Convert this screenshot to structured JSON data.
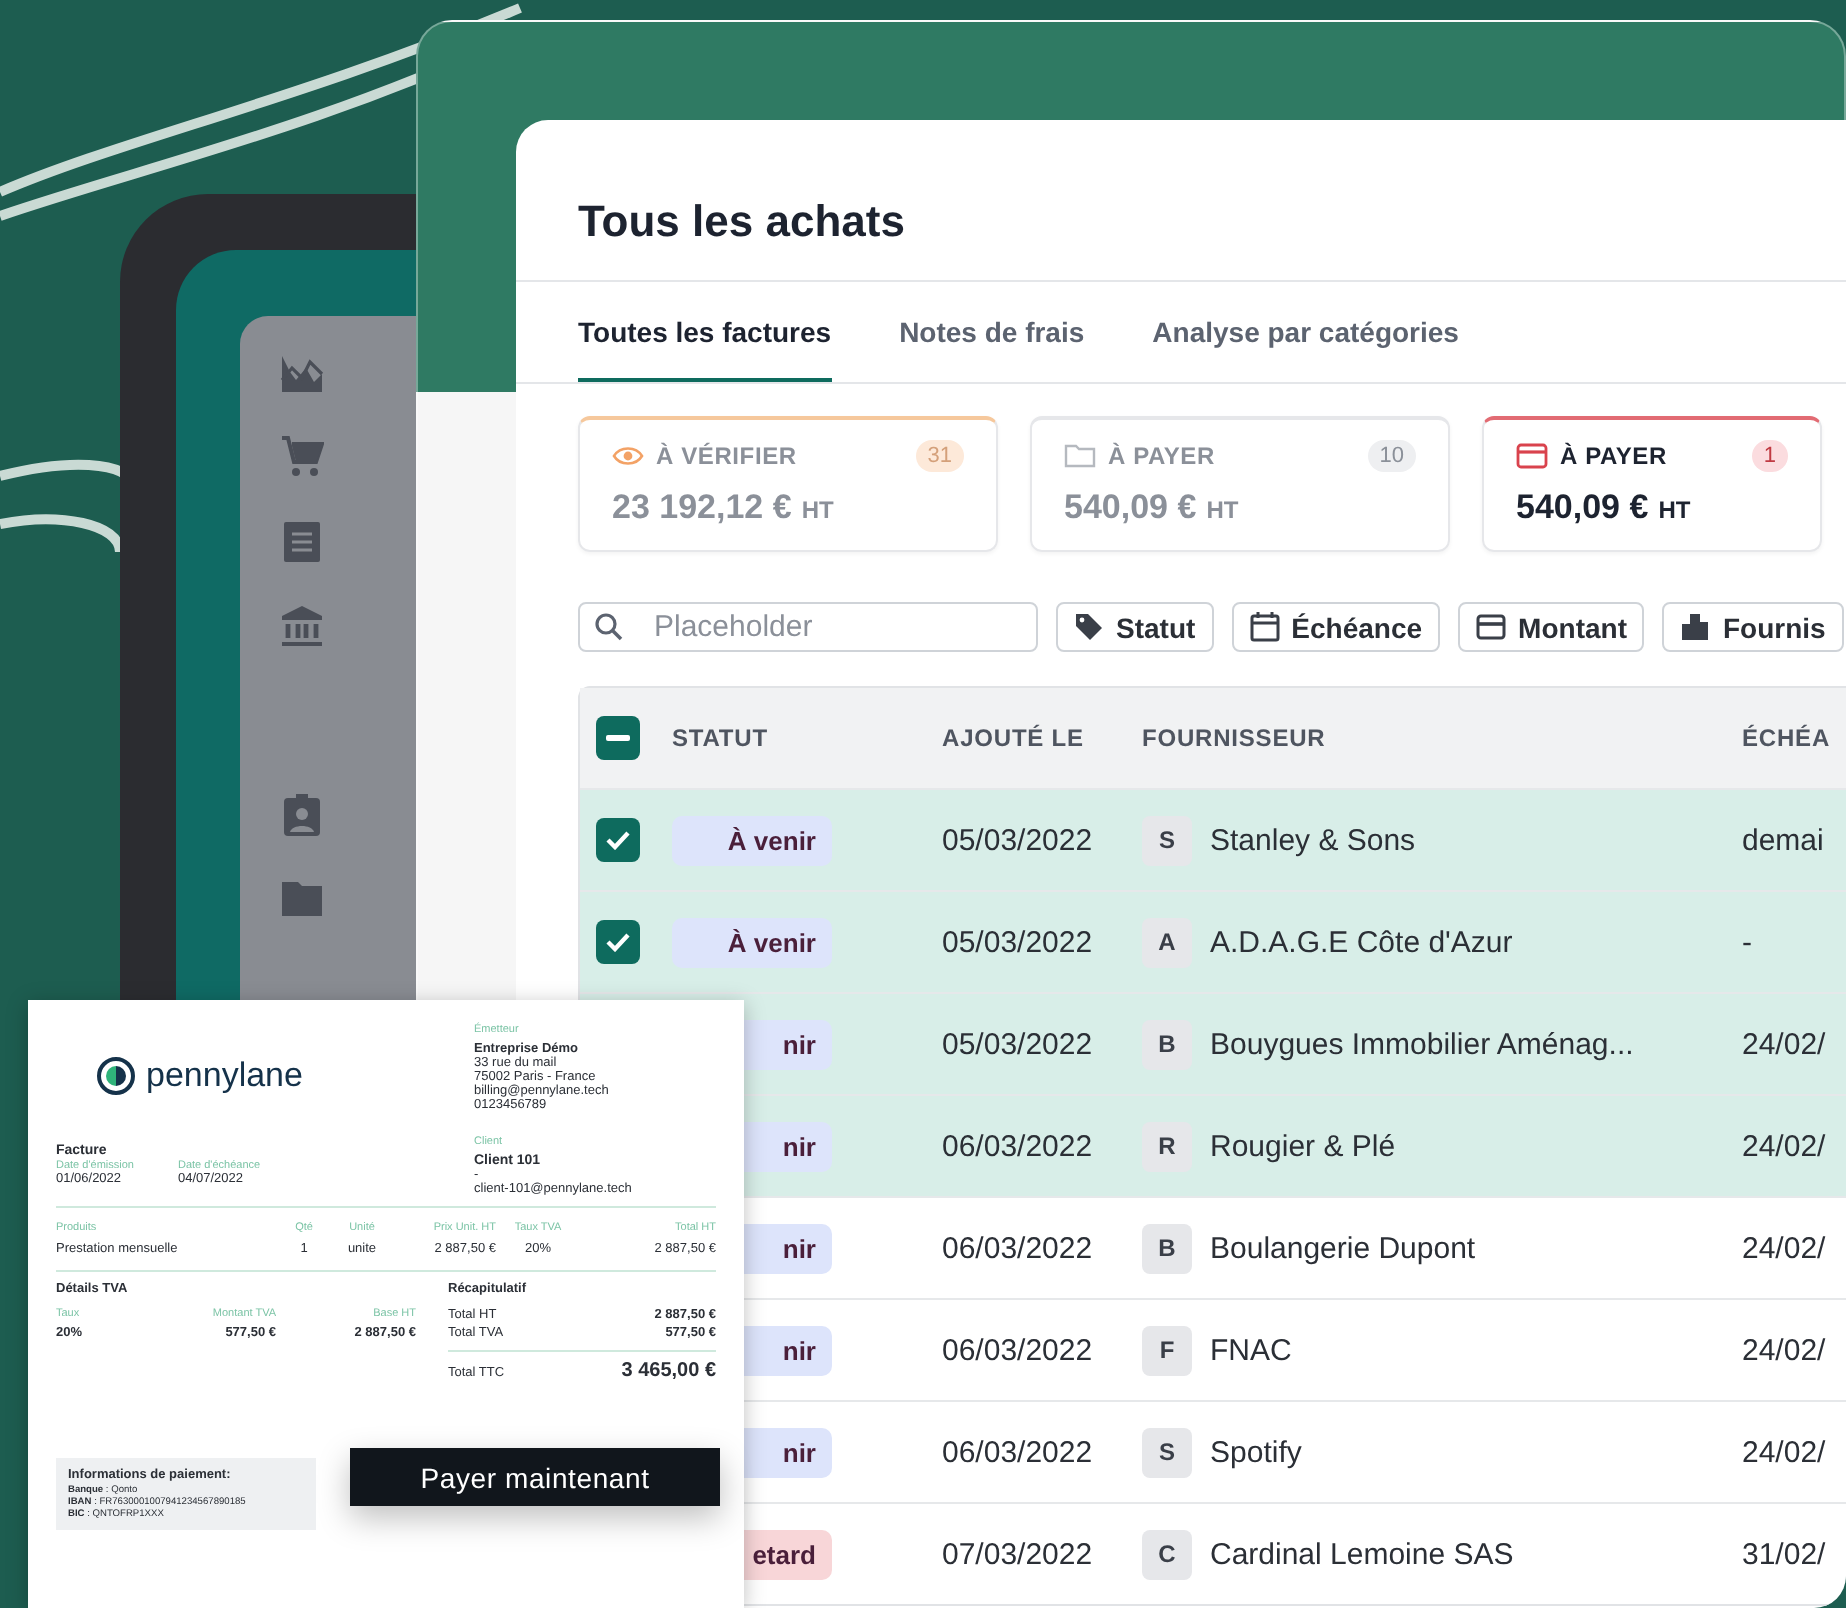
{
  "window": {
    "title": "Tous les achats"
  },
  "tabs": [
    {
      "label": "Toutes les factures",
      "selected": true
    },
    {
      "label": "Notes de frais",
      "selected": false
    },
    {
      "label": "Analyse par catégories",
      "selected": false
    }
  ],
  "summary_cards": [
    {
      "kind": "verify",
      "label": "À VÉRIFIER",
      "count": "31",
      "amount": "23 192,12 €",
      "unit": "HT",
      "selected": false
    },
    {
      "kind": "folder",
      "label": "À PAYER",
      "count": "10",
      "amount": "540,09 €",
      "unit": "HT",
      "selected": false
    },
    {
      "kind": "card",
      "label": "À PAYER",
      "count": "1",
      "amount": "540,09 €",
      "unit": "HT",
      "selected": true
    }
  ],
  "search": {
    "placeholder": "Placeholder"
  },
  "filters": [
    {
      "kind": "tag",
      "label": "Statut"
    },
    {
      "kind": "calendar",
      "label": "Échéance"
    },
    {
      "kind": "card",
      "label": "Montant"
    },
    {
      "kind": "building",
      "label": "Fournis"
    }
  ],
  "table": {
    "header_checkbox": {
      "indeterminate": true
    },
    "columns": [
      "STATUT",
      "AJOUTÉ LE",
      "FOURNISSEUR",
      "ÉCHÉA"
    ],
    "rows": [
      {
        "selected": true,
        "checked": true,
        "status": "À venir",
        "color": "#dde4fb",
        "added": "05/03/2022",
        "initial": "S",
        "supplier": "Stanley & Sons",
        "due": "demai"
      },
      {
        "selected": true,
        "checked": true,
        "status": "À venir",
        "color": "#dde4fb",
        "added": "05/03/2022",
        "initial": "A",
        "supplier": "A.D.A.G.E Côte d'Azur",
        "due": "-"
      },
      {
        "selected": true,
        "status": "nir",
        "color": "#dde4fb",
        "added": "05/03/2022",
        "initial": "B",
        "supplier": "Bouygues Immobilier Aménag...",
        "due": "24/02/"
      },
      {
        "selected": true,
        "status": "nir",
        "color": "#dde4fb",
        "added": "06/03/2022",
        "initial": "R",
        "supplier": "Rougier & Plé",
        "due": "24/02/"
      },
      {
        "selected": false,
        "status": "nir",
        "color": "#dde4fb",
        "added": "06/03/2022",
        "initial": "B",
        "supplier": "Boulangerie Dupont",
        "due": "24/02/"
      },
      {
        "selected": false,
        "status": "nir",
        "color": "#dde4fb",
        "added": "06/03/2022",
        "initial": "F",
        "supplier": "FNAC",
        "due": "24/02/"
      },
      {
        "selected": false,
        "status": "nir",
        "color": "#dde4fb",
        "added": "06/03/2022",
        "initial": "S",
        "supplier": "Spotify",
        "due": "24/02/"
      },
      {
        "selected": false,
        "status": "etard",
        "color": "#f8d6d8",
        "added": "07/03/2022",
        "initial": "C",
        "supplier": "Cardinal Lemoine SAS",
        "due": "31/02/"
      }
    ]
  },
  "invoice": {
    "logo_text": "pennylane",
    "title": "Facture",
    "dates": [
      {
        "label": "Date d'émission",
        "value": "01/06/2022"
      },
      {
        "label": "Date d'échéance",
        "value": "04/07/2022"
      }
    ],
    "issuer_label": "Émetteur",
    "issuer_name": "Entreprise Démo",
    "issuer_lines": [
      "33 rue du mail",
      "75002 Paris - France",
      "billing@pennylane.tech",
      "0123456789"
    ],
    "client_label": "Client",
    "client_name": "Client 101",
    "client_lines": [
      "-",
      "client-101@pennylane.tech"
    ],
    "product_columns": [
      "Produits",
      "Qté",
      "Unité",
      "Prix Unit. HT",
      "Taux TVA",
      "Total HT"
    ],
    "product_rows": [
      [
        "Prestation mensuelle",
        "1",
        "unite",
        "2 887,50 €",
        "20%",
        "2 887,50 €"
      ]
    ],
    "vat_title": "Détails TVA",
    "vat_columns": [
      "Taux",
      "Montant TVA",
      "Base HT"
    ],
    "vat_rows": [
      [
        "20%",
        "577,50 €",
        "2 887,50 €"
      ]
    ],
    "summary_title": "Récapitulatif",
    "summary_rows": [
      {
        "label": "Total HT",
        "value": "2 887,50 €"
      },
      {
        "label": "Total TVA",
        "value": "577,50 €"
      }
    ],
    "total": {
      "label": "Total TTC",
      "value": "3 465,00 €"
    },
    "payment": {
      "title": "Informations de paiement:",
      "lines": [
        "**Banque** : Qonto",
        "**IBAN** : FR7630001007941234567890185",
        "**BIC** : QNTOFRP1XXX"
      ]
    }
  },
  "pay_button": {
    "label": "Payer maintenant"
  }
}
